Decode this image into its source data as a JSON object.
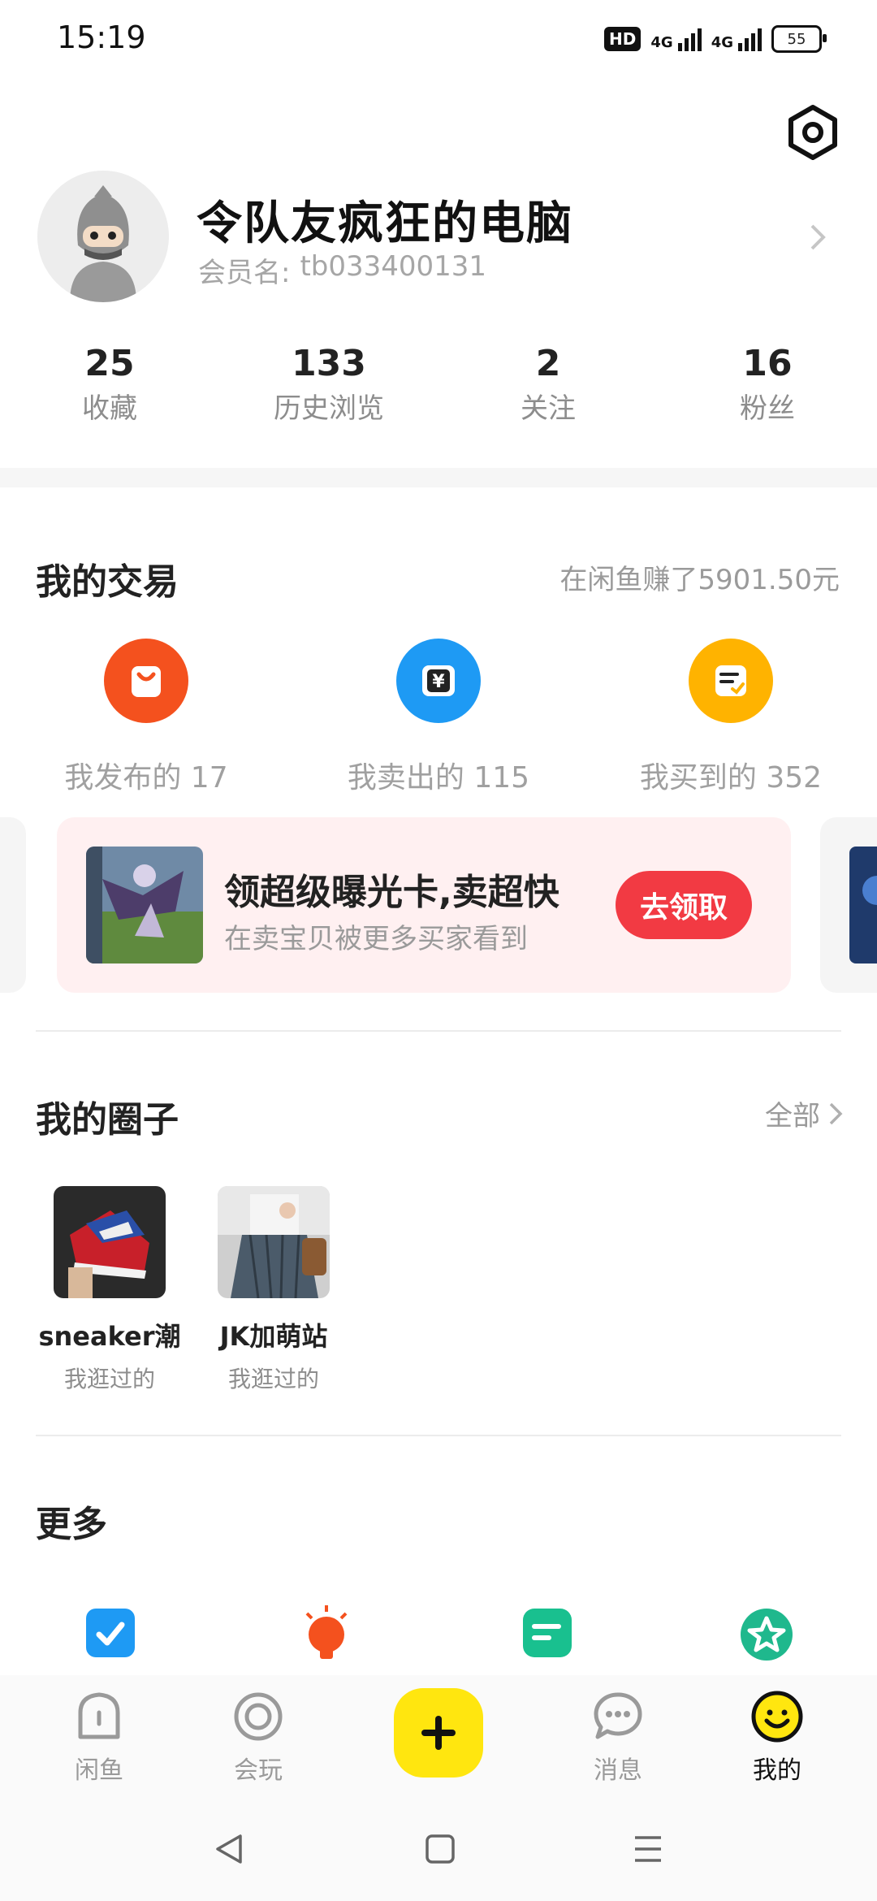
{
  "status_bar": {
    "time": "15:19",
    "hd_badge": "HD",
    "network_1": "4G",
    "network_2": "4G",
    "battery": "55"
  },
  "profile": {
    "nickname": "令队友疯狂的电脑",
    "member_prefix": "会员名:",
    "member_id": "tb033400131"
  },
  "stats": [
    {
      "value": "25",
      "label": "收藏"
    },
    {
      "value": "133",
      "label": "历史浏览"
    },
    {
      "value": "2",
      "label": "关注"
    },
    {
      "value": "16",
      "label": "粉丝"
    }
  ],
  "trade": {
    "title": "我的交易",
    "earned": "在闲鱼赚了5901.50元",
    "items": [
      {
        "label": "我发布的 17",
        "icon": "shopping-bag-icon",
        "color": "#f4511e"
      },
      {
        "label": "我卖出的 115",
        "icon": "yuan-icon",
        "color": "#1e9af4"
      },
      {
        "label": "我买到的 352",
        "icon": "receipt-check-icon",
        "color": "#ffb300"
      }
    ]
  },
  "banner": {
    "title": "领超级曝光卡,卖超快",
    "subtitle": "在卖宝贝被更多买家看到",
    "button": "去领取"
  },
  "circles": {
    "title": "我的圈子",
    "all_label": "全部",
    "items": [
      {
        "name": "sneaker潮",
        "sub": "我逛过的"
      },
      {
        "name": "JK加萌站",
        "sub": "我逛过的"
      }
    ]
  },
  "more": {
    "title": "更多",
    "icons": [
      {
        "icon": "check-badge-icon",
        "color": "#1e9af4"
      },
      {
        "icon": "lightbulb-icon",
        "color": "#f4511e"
      },
      {
        "icon": "note-icon",
        "color": "#19c08f"
      },
      {
        "icon": "star-circle-icon",
        "color": "#1fb88d"
      }
    ]
  },
  "tabbar": [
    {
      "label": "闲鱼",
      "icon": "home-icon"
    },
    {
      "label": "会玩",
      "icon": "target-icon"
    },
    {
      "label": "消息",
      "icon": "chat-icon"
    },
    {
      "label": "我的",
      "icon": "smile-icon"
    }
  ],
  "colors": {
    "accent_yellow": "#ffe60f",
    "banner_button": "#f23a43",
    "banner_bg": "#fff0f1"
  }
}
